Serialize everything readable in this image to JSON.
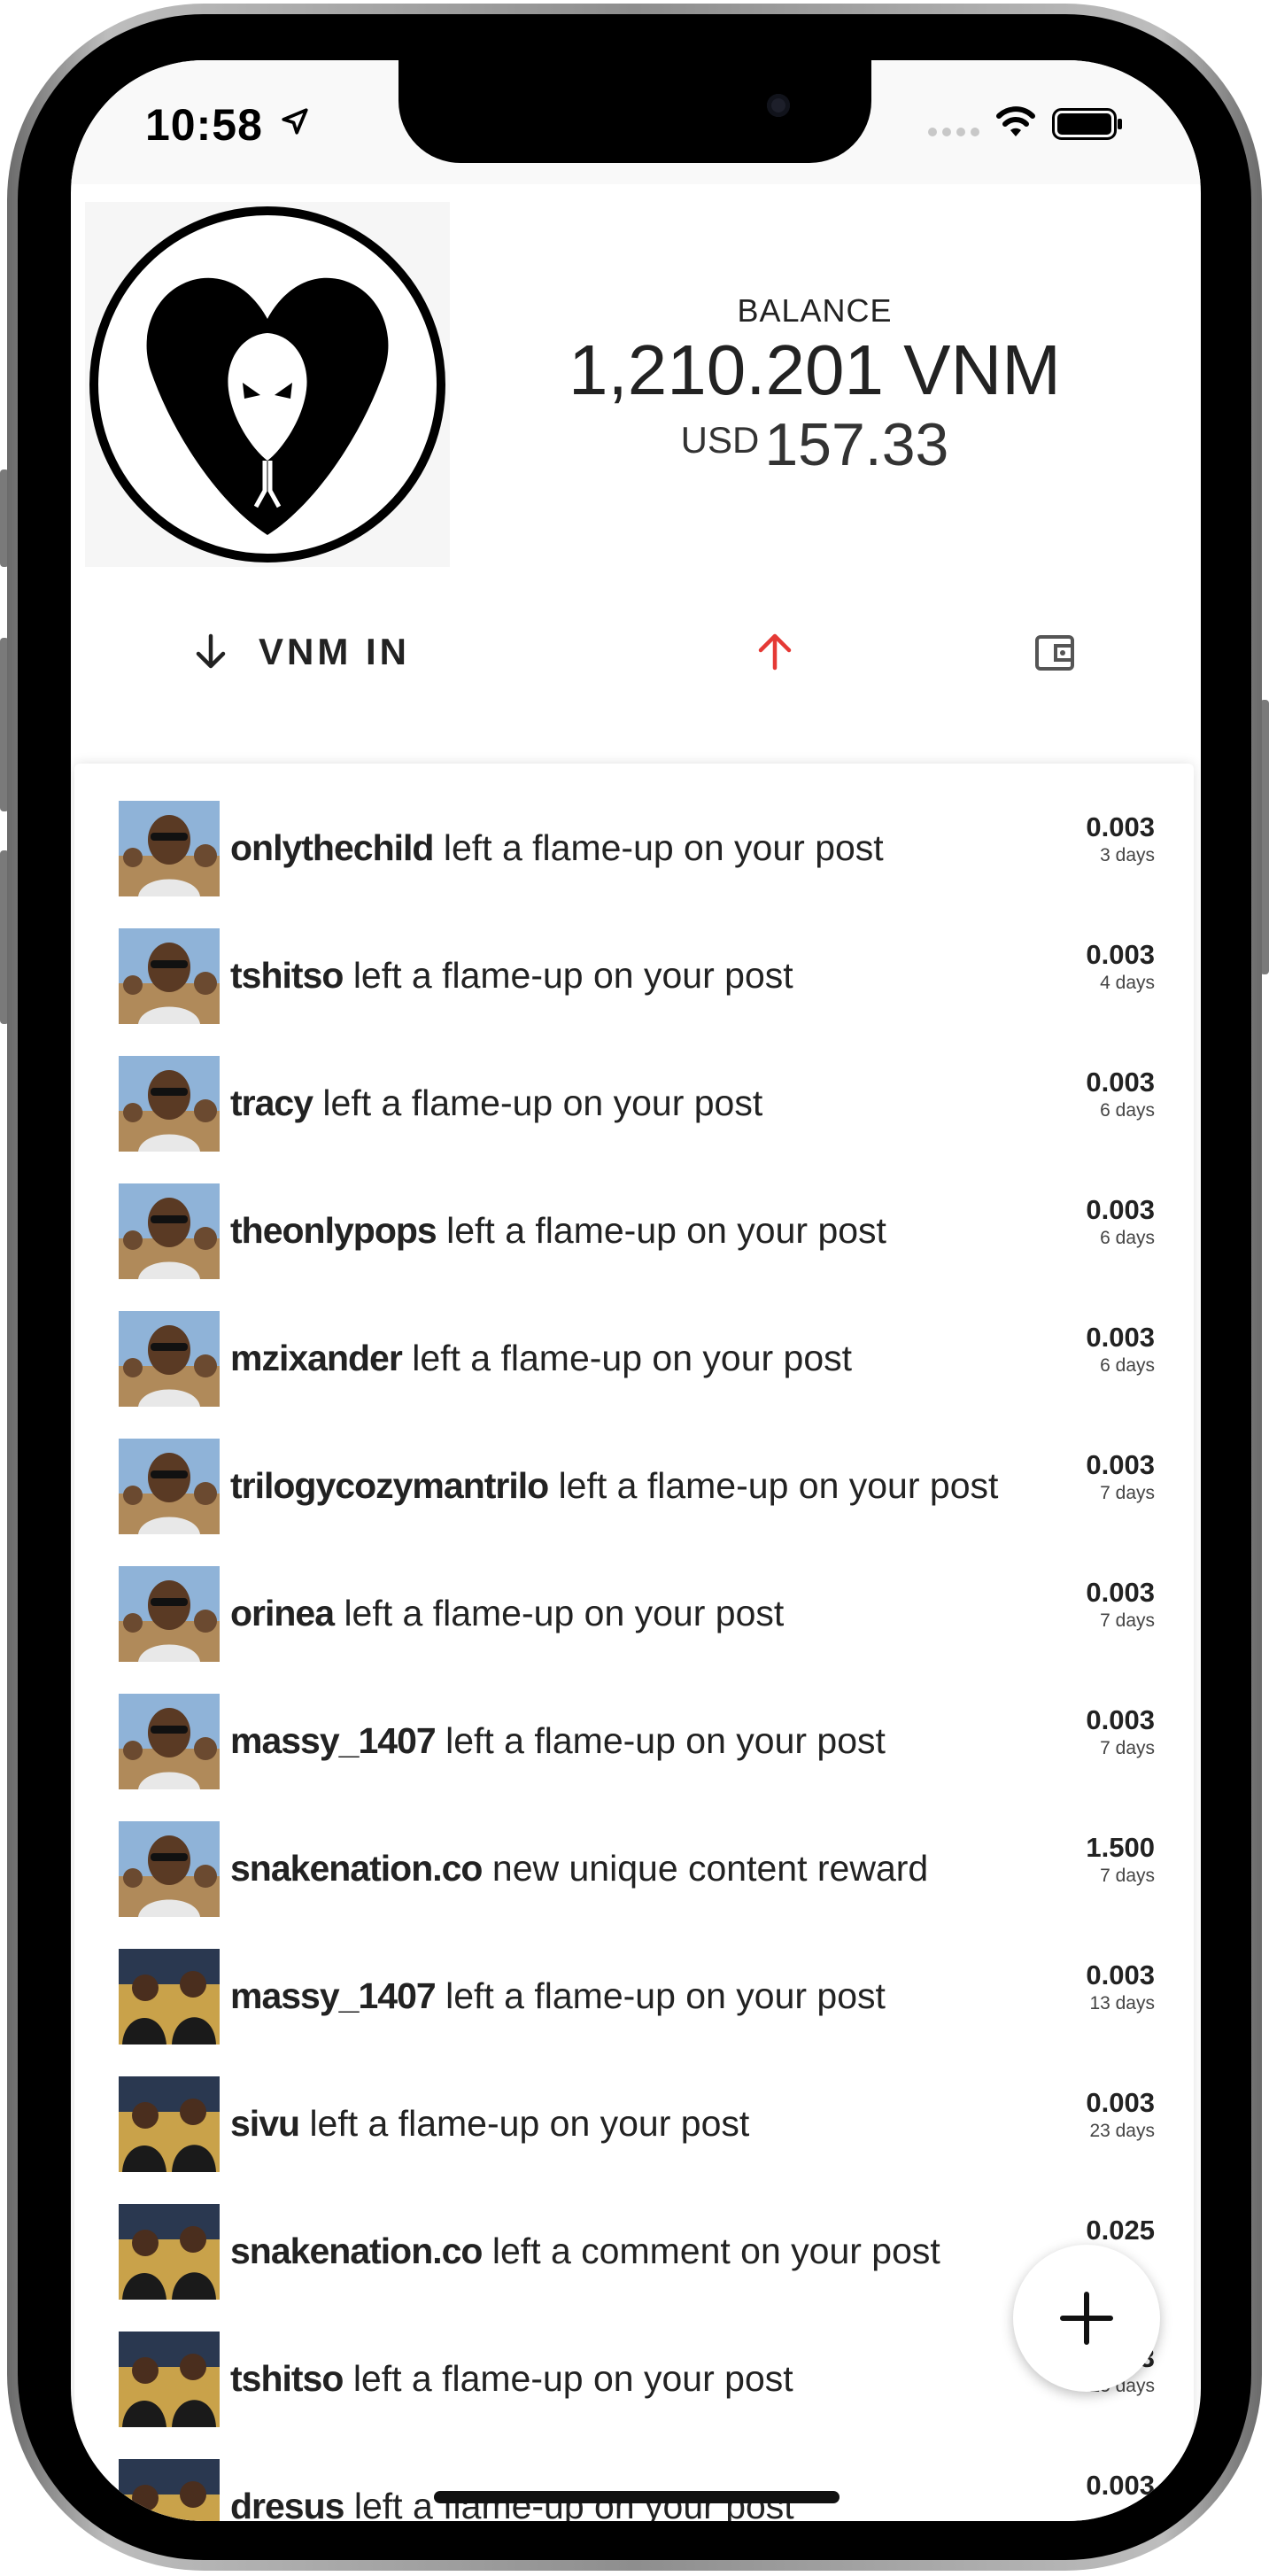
{
  "status_bar": {
    "time": "10:58"
  },
  "wallet": {
    "balance_label": "BALANCE",
    "balance": "1,210.201 VNM",
    "usd_currency": "USD",
    "usd_value": "157.33",
    "vnm_in_label": "VNM IN"
  },
  "colors": {
    "send_arrow": "#e53935",
    "text": "#222222"
  },
  "icons": {
    "receive": "arrow-down-icon",
    "send": "arrow-up-icon",
    "wallet": "wallet-icon",
    "add": "plus-icon"
  },
  "transactions": [
    {
      "user": "onlythechild",
      "action": "left a flame-up on your post",
      "amount": "0.003",
      "age": "3 days",
      "avatar": "a"
    },
    {
      "user": "tshitso",
      "action": "left a flame-up on your post",
      "amount": "0.003",
      "age": "4 days",
      "avatar": "a"
    },
    {
      "user": "tracy",
      "action": "left a flame-up on your post",
      "amount": "0.003",
      "age": "6 days",
      "avatar": "a"
    },
    {
      "user": "theonlypops",
      "action": "left a flame-up on your post",
      "amount": "0.003",
      "age": "6 days",
      "avatar": "a"
    },
    {
      "user": "mzixander",
      "action": "left a flame-up on your post",
      "amount": "0.003",
      "age": "6 days",
      "avatar": "a"
    },
    {
      "user": "trilogycozymantrilo",
      "action": "left a flame-up on your post",
      "amount": "0.003",
      "age": "7 days",
      "avatar": "a"
    },
    {
      "user": "orinea",
      "action": "left a flame-up on your post",
      "amount": "0.003",
      "age": "7 days",
      "avatar": "a"
    },
    {
      "user": "massy_1407",
      "action": "left a flame-up on your post",
      "amount": "0.003",
      "age": "7 days",
      "avatar": "a"
    },
    {
      "user": "snakenation.co",
      "action": "new unique content reward",
      "amount": "1.500",
      "age": "7 days",
      "avatar": "a"
    },
    {
      "user": "massy_1407",
      "action": "left a flame-up on your post",
      "amount": "0.003",
      "age": "13 days",
      "avatar": "b"
    },
    {
      "user": "sivu",
      "action": "left a flame-up on your post",
      "amount": "0.003",
      "age": "23 days",
      "avatar": "b"
    },
    {
      "user": "snakenation.co",
      "action": "left a comment on your post",
      "amount": "0.025",
      "age": "",
      "avatar": "b"
    },
    {
      "user": "tshitso",
      "action": "left a flame-up on your post",
      "amount": "0.003",
      "age": "25 days",
      "avatar": "b"
    },
    {
      "user": "dresus",
      "action": "left a flame-up on your post",
      "amount": "0.003",
      "age": "",
      "avatar": "b"
    }
  ]
}
